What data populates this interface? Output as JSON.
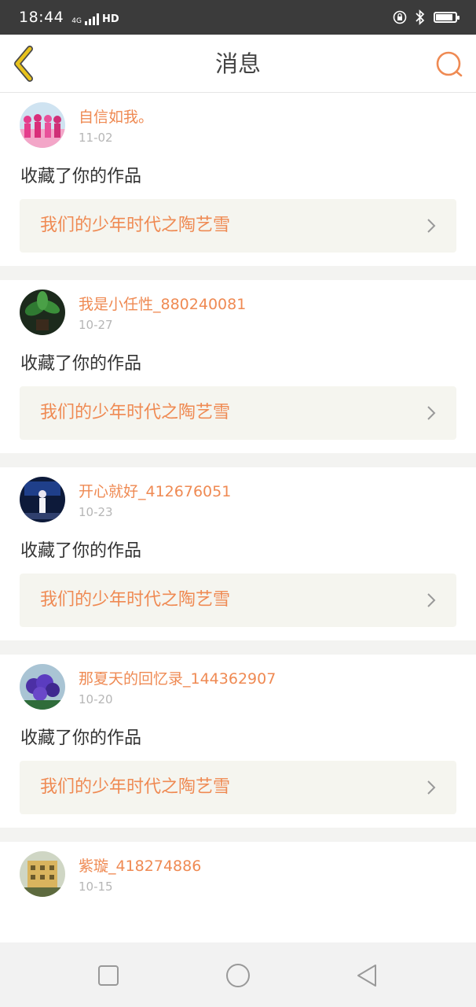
{
  "status_bar": {
    "time": "18:44",
    "network": "4G",
    "hd": "HD",
    "battery_level": 0.9
  },
  "header": {
    "title": "消息"
  },
  "messages": [
    {
      "name": "自信如我。",
      "date": "11-02",
      "action": "收藏了你的作品",
      "work_title": "我们的少年时代之陶艺雪",
      "avatar": "group-dance-photo"
    },
    {
      "name": "我是小任性_880240081",
      "date": "10-27",
      "action": "收藏了你的作品",
      "work_title": "我们的少年时代之陶艺雪",
      "avatar": "plant-photo"
    },
    {
      "name": "开心就好_412676051",
      "date": "10-23",
      "action": "收藏了你的作品",
      "work_title": "我们的少年时代之陶艺雪",
      "avatar": "stage-performer-photo"
    },
    {
      "name": "那夏天的回忆录_144362907",
      "date": "10-20",
      "action": "收藏了你的作品",
      "work_title": "我们的少年时代之陶艺雪",
      "avatar": "purple-flowers-photo"
    },
    {
      "name": "紫璇_418274886",
      "date": "10-15",
      "action": "",
      "work_title": "",
      "avatar": "building-photo"
    }
  ],
  "colors": {
    "accent": "#ef8a53",
    "back_arrow": "#e8c21c",
    "status_bar": "#3b3b3b",
    "card_bg": "#f5f5ef"
  }
}
